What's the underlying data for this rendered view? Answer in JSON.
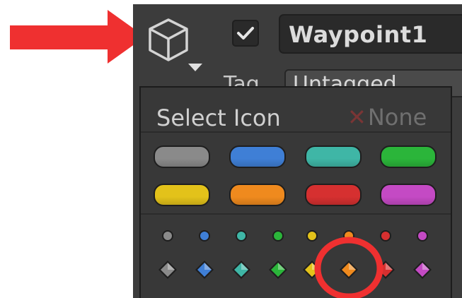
{
  "inspector": {
    "object_name": "Waypoint1",
    "active_checked": true,
    "tag_label": "Tag",
    "tag_value": "Untagged"
  },
  "icon_popup": {
    "title": "Select Icon",
    "none_label": "None",
    "label_colors": [
      "#8a8a8a",
      "#3f7fd6",
      "#3fb6a6",
      "#2bb53a",
      "#e3c21a",
      "#ef8a1e",
      "#d63030",
      "#c44ac4"
    ],
    "shape_colors": [
      "#8a8a8a",
      "#3f7fd6",
      "#3fb6a6",
      "#2bb53a",
      "#e3c21a",
      "#ef8a1e",
      "#d63030",
      "#c44ac4"
    ],
    "selected_diamond": "orange-diamond-icon"
  },
  "annotations": {
    "arrow_color": "#ef3030",
    "highlight_color": "#ef3030"
  }
}
